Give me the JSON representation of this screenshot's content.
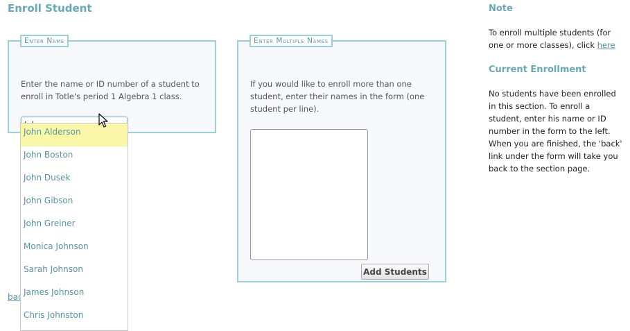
{
  "page": {
    "title": "Enroll Student"
  },
  "enter_name": {
    "legend": "Enter Name",
    "help": "Enter the name or ID number of a student to enroll in Totle's period 1 Algebra 1 class.",
    "input_value": "John"
  },
  "suggestions": [
    "John Alderson",
    "John Boston",
    "John Dusek",
    "John Gibson",
    "John Greiner",
    "Monica Johnson",
    "Sarah Johnson",
    "James Johnson",
    "Chris Johnston"
  ],
  "enter_multiple": {
    "legend": "Enter Multiple Names",
    "help": "If you would like to enroll more than one student, enter their names in the form (one student per line).",
    "button_label": "Add Students"
  },
  "back_link": "back",
  "note": {
    "heading": "Note",
    "text": "To enroll multiple students (for one or more classes), click",
    "link": "here"
  },
  "current": {
    "heading": "Current Enrollment",
    "text": "No students have been enrolled in this section. To enroll a student, enter his name or ID number in the form to the left. When you are finished, the 'back' link under the form will take you back to the section page."
  },
  "colors": {
    "accent": "#6aa9b4",
    "border": "#9fcfd6",
    "highlight": "#fbf7a8"
  },
  "icons": {
    "cursor": "mouse-pointer-icon"
  }
}
